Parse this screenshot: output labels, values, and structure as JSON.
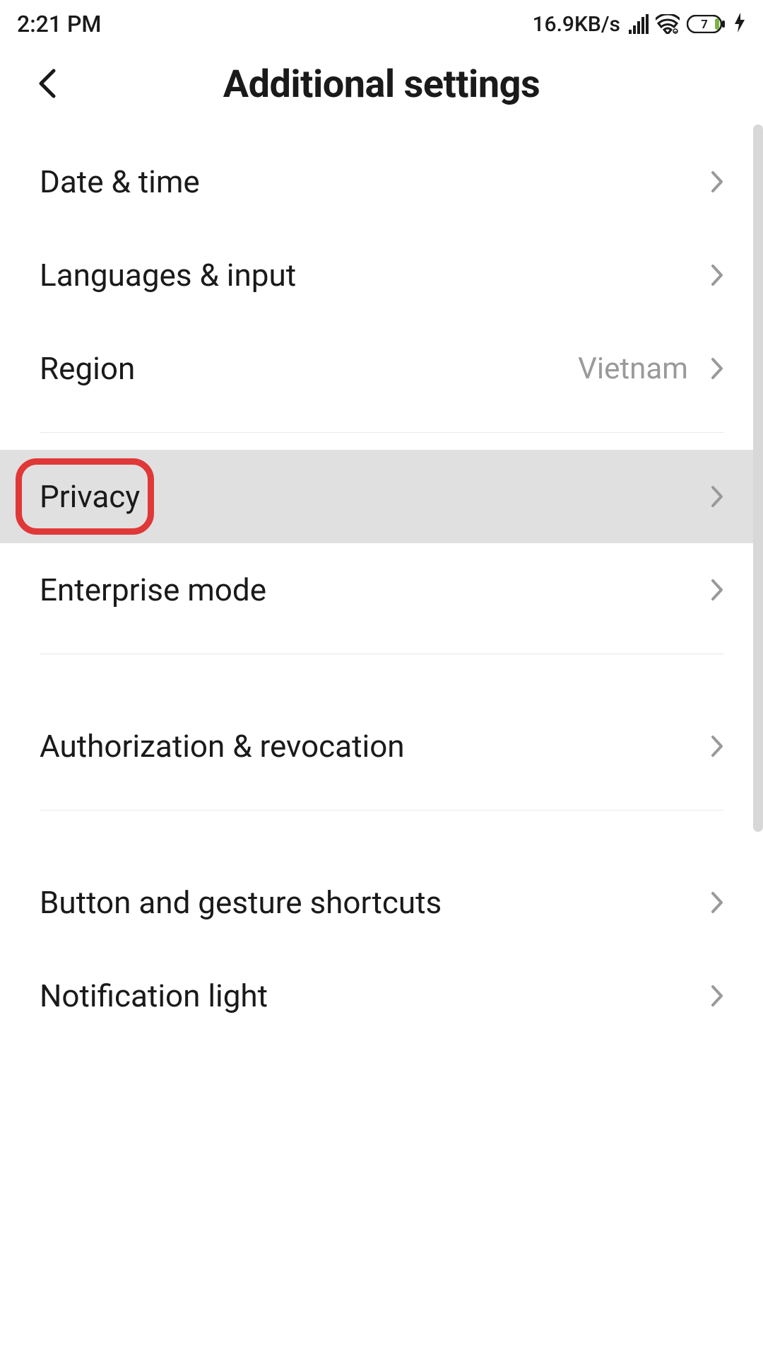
{
  "status_bar": {
    "time": "2:21 PM",
    "speed": "16.9KB/s",
    "battery_level": "7"
  },
  "header": {
    "title": "Additional settings"
  },
  "settings": {
    "date_time": {
      "label": "Date & time"
    },
    "languages": {
      "label": "Languages & input"
    },
    "region": {
      "label": "Region",
      "value": "Vietnam"
    },
    "privacy": {
      "label": "Privacy"
    },
    "enterprise": {
      "label": "Enterprise mode"
    },
    "authorization": {
      "label": "Authorization & revocation"
    },
    "button_gesture": {
      "label": "Button and gesture shortcuts"
    },
    "notification_light": {
      "label": "Notification light"
    }
  }
}
